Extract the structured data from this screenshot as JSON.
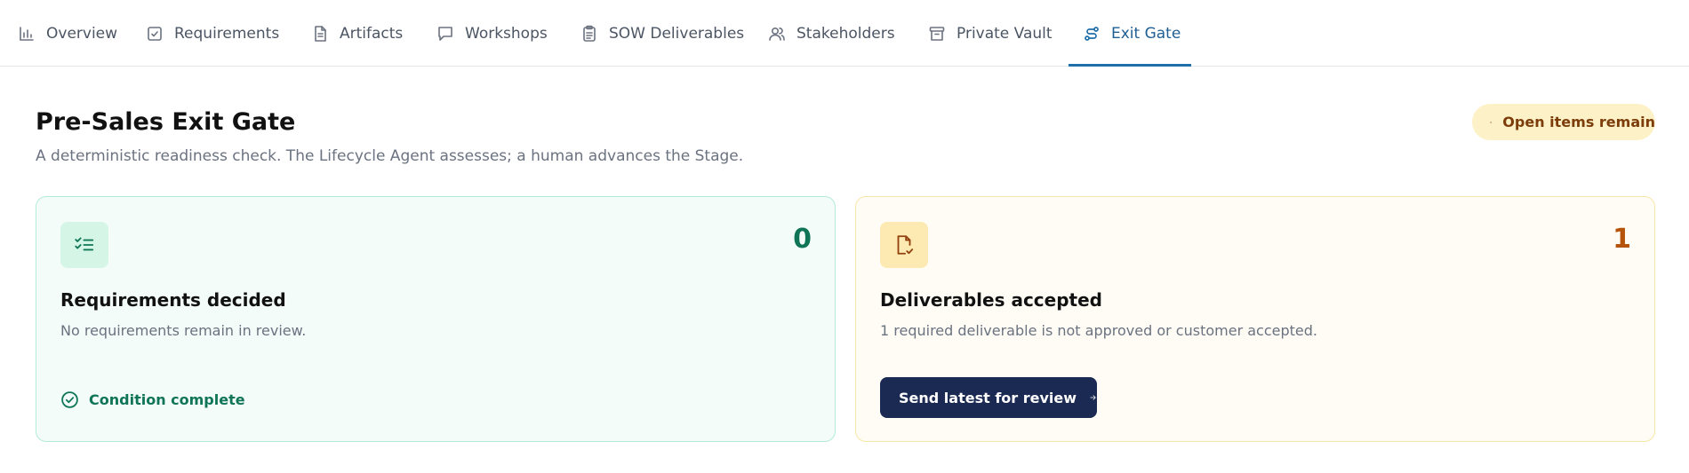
{
  "tabs": [
    {
      "label": "Overview",
      "icon": "bar-chart-icon"
    },
    {
      "label": "Requirements",
      "icon": "check-square-icon"
    },
    {
      "label": "Artifacts",
      "icon": "document-icon"
    },
    {
      "label": "Workshops",
      "icon": "chat-bubble-icon"
    },
    {
      "label": "SOW Deliverables",
      "icon": "clipboard-icon"
    },
    {
      "label": "Stakeholders",
      "icon": "users-icon"
    },
    {
      "label": "Private Vault",
      "icon": "archive-icon"
    },
    {
      "label": "Exit Gate",
      "icon": "route-icon",
      "active": true
    }
  ],
  "header": {
    "title": "Pre-Sales Exit Gate",
    "subtitle": "A deterministic readiness check. The Lifecycle Agent assesses; a human advances the Stage."
  },
  "status_badge": {
    "label": "Open items remain",
    "icon": "alert-circle-icon"
  },
  "cards": [
    {
      "icon": "list-checks-icon",
      "count": "0",
      "title": "Requirements decided",
      "description": "No requirements remain in review.",
      "status_label": "Condition complete",
      "status_icon": "check-circle-icon"
    },
    {
      "icon": "file-check-icon",
      "count": "1",
      "title": "Deliverables accepted",
      "description": "1 required deliverable is not approved or customer accepted.",
      "action_label": "Send latest for review",
      "action_icon": "arrow-right-icon"
    }
  ],
  "colors": {
    "accent": "#1f6fab",
    "success": "#0f7556",
    "warning": "#b45309",
    "badge_bg": "#fdf1c7",
    "button_bg": "#1b2a52"
  }
}
